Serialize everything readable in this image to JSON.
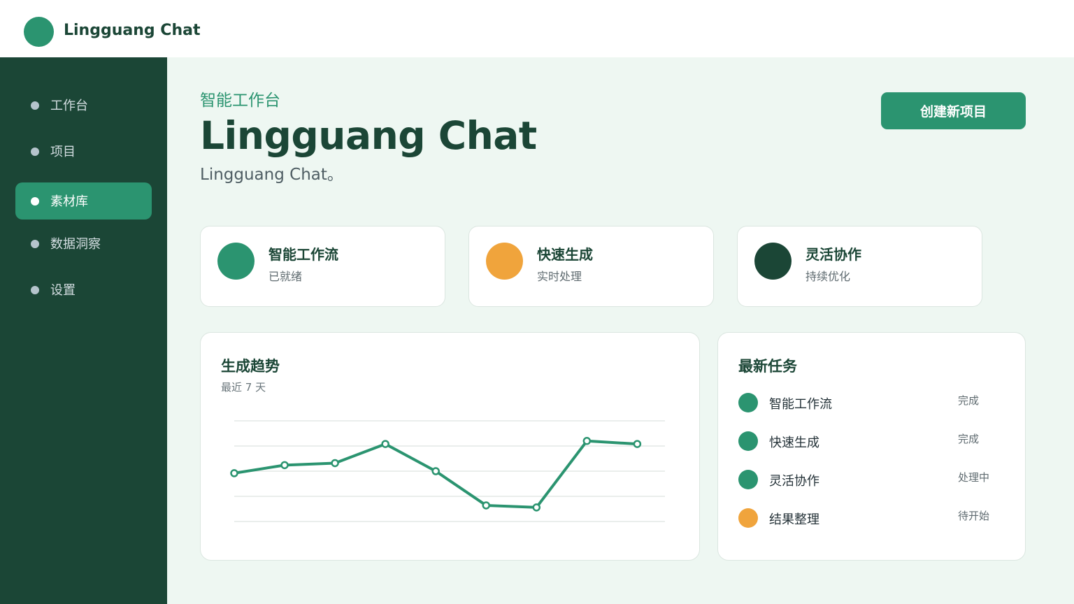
{
  "app": {
    "name": "Lingguang Chat"
  },
  "sidebar": {
    "items": [
      {
        "label": "工作台",
        "active": false
      },
      {
        "label": "项目",
        "active": false
      },
      {
        "label": "素材库",
        "active": true
      },
      {
        "label": "数据洞察",
        "active": false
      },
      {
        "label": "设置",
        "active": false
      }
    ]
  },
  "header": {
    "eyebrow": "智能工作台",
    "title": "Lingguang Chat",
    "subtitle": "Lingguang Chat。",
    "create_button": "创建新项目"
  },
  "stats": [
    {
      "title": "智能工作流",
      "subtitle": "已就绪",
      "color": "#2b9470"
    },
    {
      "title": "快速生成",
      "subtitle": "实时处理",
      "color": "#f0a43c"
    },
    {
      "title": "灵活协作",
      "subtitle": "持续优化",
      "color": "#1b4636"
    }
  ],
  "trend": {
    "title": "生成趋势",
    "subtitle": "最近 7 天"
  },
  "chart_data": {
    "type": "line",
    "x": [
      1,
      2,
      3,
      4,
      5,
      6,
      7,
      8,
      9
    ],
    "values": [
      48,
      56,
      58,
      77,
      50,
      16,
      14,
      80,
      77
    ],
    "ylim": [
      0,
      100
    ],
    "grid": true,
    "color": "#2b9470"
  },
  "tasks": {
    "title": "最新任务",
    "items": [
      {
        "name": "智能工作流",
        "status": "完成",
        "color": "#2b9470"
      },
      {
        "name": "快速生成",
        "status": "完成",
        "color": "#2b9470"
      },
      {
        "name": "灵活协作",
        "status": "处理中",
        "color": "#2b9470"
      },
      {
        "name": "结果整理",
        "status": "待开始",
        "color": "#f0a43c"
      }
    ]
  },
  "colors": {
    "accent": "#2b9470",
    "dark": "#1b4636",
    "orange": "#f0a43c"
  }
}
